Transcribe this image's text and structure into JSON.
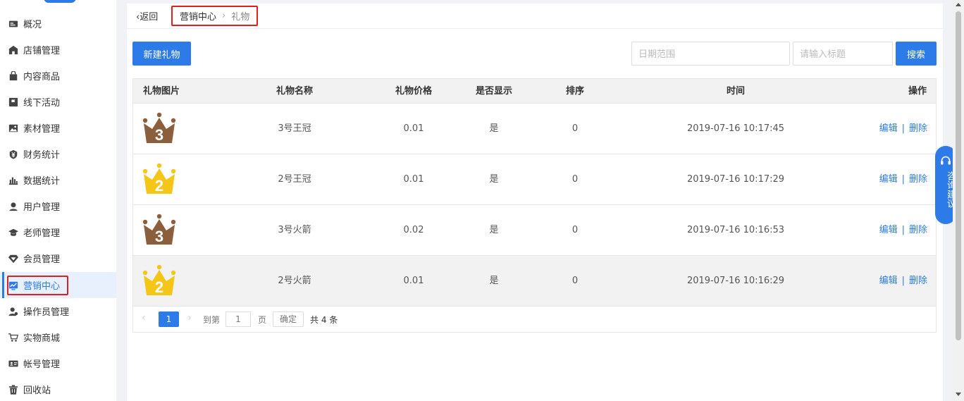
{
  "sidebar": {
    "items": [
      {
        "label": "概况",
        "icon": "overview-icon"
      },
      {
        "label": "店铺管理",
        "icon": "store-icon"
      },
      {
        "label": "内容商品",
        "icon": "bag-icon"
      },
      {
        "label": "线下活动",
        "icon": "flag-icon"
      },
      {
        "label": "素材管理",
        "icon": "image-icon"
      },
      {
        "label": "财务统计",
        "icon": "yen-icon"
      },
      {
        "label": "数据统计",
        "icon": "bar-chart-icon"
      },
      {
        "label": "用户管理",
        "icon": "user-icon"
      },
      {
        "label": "老师管理",
        "icon": "graduation-cap-icon"
      },
      {
        "label": "会员管理",
        "icon": "diamond-icon"
      },
      {
        "label": "营销中心",
        "icon": "trend-icon",
        "active": true
      },
      {
        "label": "操作员管理",
        "icon": "operator-icon"
      },
      {
        "label": "实物商城",
        "icon": "cart-icon"
      },
      {
        "label": "帐号管理",
        "icon": "id-card-icon"
      },
      {
        "label": "回收站",
        "icon": "trash-icon"
      }
    ]
  },
  "topbar": {
    "back_label": "返回",
    "breadcrumb": [
      "营销中心",
      "礼物"
    ]
  },
  "toolbar": {
    "new_label": "新建礼物",
    "date_placeholder": "日期范围",
    "title_placeholder": "请输入标题",
    "search_label": "搜索"
  },
  "table": {
    "headers": [
      "礼物图片",
      "礼物名称",
      "礼物价格",
      "是否显示",
      "排序",
      "时间",
      "操作"
    ],
    "rows": [
      {
        "crown": "3",
        "crown_color": "#8b5e3c",
        "name": "3号王冠",
        "price": "0.01",
        "show": "是",
        "sort": "0",
        "time": "2019-07-16 10:17:45"
      },
      {
        "crown": "2",
        "crown_color": "#f5c518",
        "name": "2号王冠",
        "price": "0.01",
        "show": "是",
        "sort": "0",
        "time": "2019-07-16 10:17:29"
      },
      {
        "crown": "3",
        "crown_color": "#8b5e3c",
        "name": "3号火箭",
        "price": "0.02",
        "show": "是",
        "sort": "0",
        "time": "2019-07-16 10:16:53"
      },
      {
        "crown": "2",
        "crown_color": "#f5c518",
        "name": "2号火箭",
        "price": "0.01",
        "show": "是",
        "sort": "0",
        "time": "2019-07-16 10:16:29"
      }
    ],
    "edit_label": "编辑",
    "op_separator": "|",
    "delete_label": "删除"
  },
  "pagination": {
    "current_page": "1",
    "goto_label": "到第",
    "goto_value": "1",
    "page_label": "页",
    "confirm_label": "确定",
    "total_label": "共 4 条"
  },
  "consult": {
    "label": "咨询建议"
  },
  "colors": {
    "accent": "#2d7be8",
    "highlight_box": "#e02020",
    "crown_bronze": "#8b5e3c",
    "crown_gold": "#f5c518"
  }
}
